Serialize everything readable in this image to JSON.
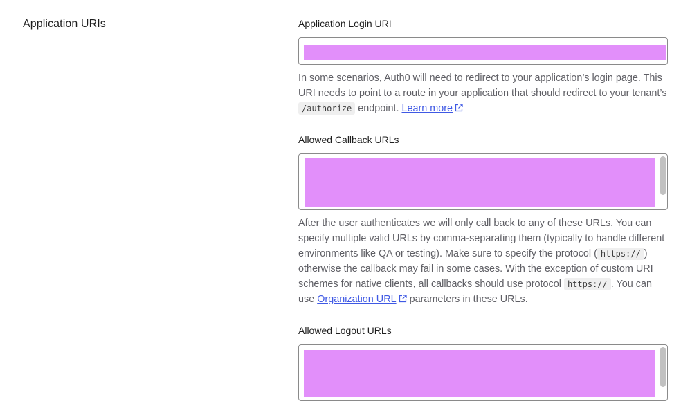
{
  "section": {
    "title": "Application URIs"
  },
  "login_uri": {
    "label": "Application Login URI",
    "help_pre": "In some scenarios, Auth0 will need to redirect to your application’s login page. This URI needs to point to a route in your application that should redirect to your tenant’s ",
    "help_code": "/authorize",
    "help_mid": " endpoint. ",
    "learn_more": "Learn more"
  },
  "callback_urls": {
    "label": "Allowed Callback URLs",
    "help_1": "After the user authenticates we will only call back to any of these URLs. You can specify multiple valid URLs by comma-separating them (typically to handle different environments like QA or testing). Make sure to specify the protocol (",
    "code_1": "https://",
    "help_2": ") otherwise the callback may fail in some cases. With the exception of custom URI schemes for native clients, all callbacks should use protocol ",
    "code_2": "https://",
    "help_3": ". You can use ",
    "org_link": "Organization URL",
    "help_4": " parameters in these URLs."
  },
  "logout_urls": {
    "label": "Allowed Logout URLs"
  },
  "colors": {
    "link": "#3f59e4",
    "redaction": "#e28ffa"
  },
  "icons": {
    "external_link": "external-link-icon"
  }
}
